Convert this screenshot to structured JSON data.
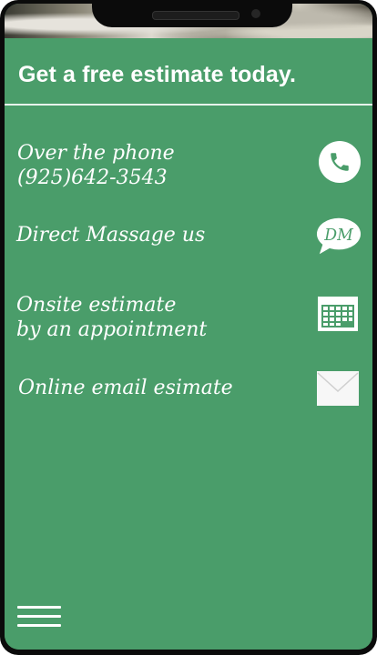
{
  "header": {
    "title": "Get a free estimate today."
  },
  "options": [
    {
      "label": "Over the phone\n(925)642-3543",
      "icon": "phone-icon"
    },
    {
      "label": "Direct Massage us",
      "icon": "dm-chat-icon",
      "icon_text": "DM"
    },
    {
      "label": "Onsite estimate\nby an appointment",
      "icon": "calendar-icon"
    },
    {
      "label": "Online email esimate",
      "icon": "mail-icon"
    }
  ],
  "footer": {
    "menu_icon": "hamburger-menu-icon"
  },
  "colors": {
    "panel_green": "#4a9d6a",
    "text": "#ffffff",
    "frame": "#0b0b0b"
  }
}
